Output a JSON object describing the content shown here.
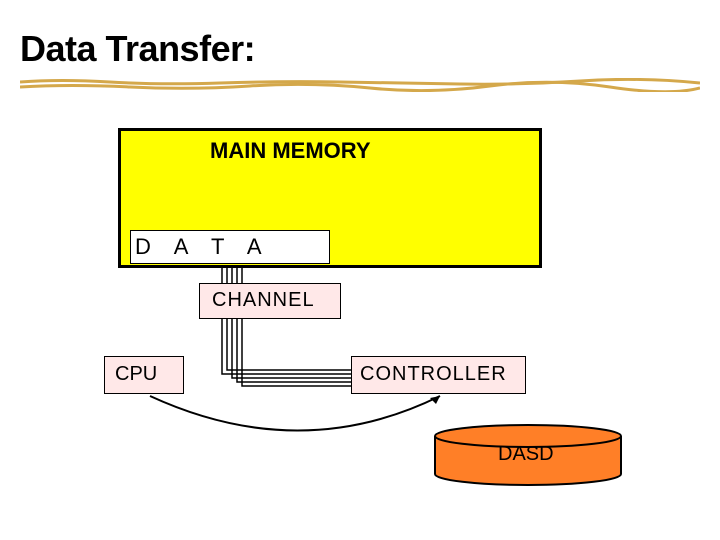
{
  "title": "Data Transfer:",
  "blocks": {
    "main_memory": "MAIN MEMORY",
    "data": "D A T A",
    "channel": "CHANNEL",
    "cpu": "CPU",
    "controller": "CONTROLLER",
    "dasd": "DASD"
  },
  "colors": {
    "memory_fill": "#ffff00",
    "box_fill": "#ffe8e8",
    "dasd_fill": "#ff7f27",
    "underline": "#d4a84b"
  }
}
